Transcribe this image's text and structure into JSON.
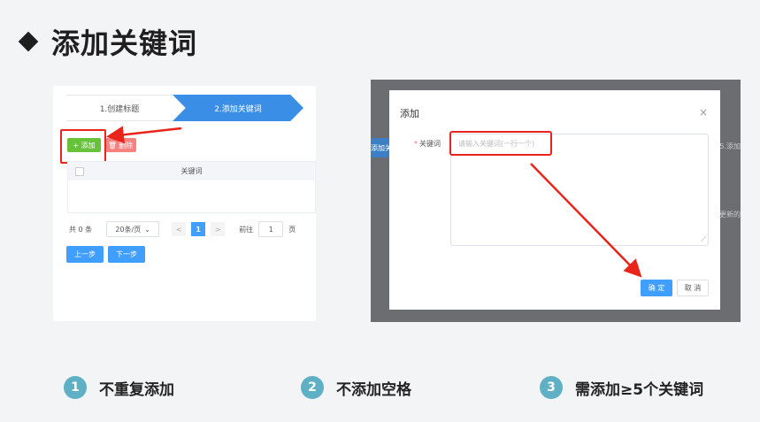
{
  "slide": {
    "title": "添加关键词"
  },
  "left_shot": {
    "steps": [
      "1.创建标题",
      "2.添加关键词"
    ],
    "add_button": "+ 添加",
    "delete_button": "删除",
    "delete_icon": "trash-icon",
    "table_header": "关键词",
    "pager": {
      "total": "共 0 条",
      "page_size": "20条/页",
      "prev": "<",
      "current_page": "1",
      "next": ">",
      "goto_label": "前往",
      "goto_value": "1",
      "unit": "页"
    },
    "prev_step_button": "上一步",
    "next_step_button": "下一步"
  },
  "right_shot": {
    "bg_tab": "添加关",
    "bg_text_1": "5.添加",
    "bg_text_2": "更新的",
    "dialog": {
      "title": "添加",
      "close": "×",
      "field_required_mark": "*",
      "field_label": "关键词",
      "placeholder": "请输入关键词(一行一个)",
      "confirm": "确 定",
      "cancel": "取 消"
    }
  },
  "notes": [
    {
      "num": "1",
      "text": "不重复添加"
    },
    {
      "num": "2",
      "text": "不添加空格"
    },
    {
      "num": "3",
      "text": "需添加≥5个关键词"
    }
  ],
  "colors": {
    "annotation_red": "#e8241b",
    "primary_blue": "#409eff",
    "success_green": "#67c23a",
    "danger_red": "#f56c6c",
    "badge_teal": "#5fb0c4"
  }
}
